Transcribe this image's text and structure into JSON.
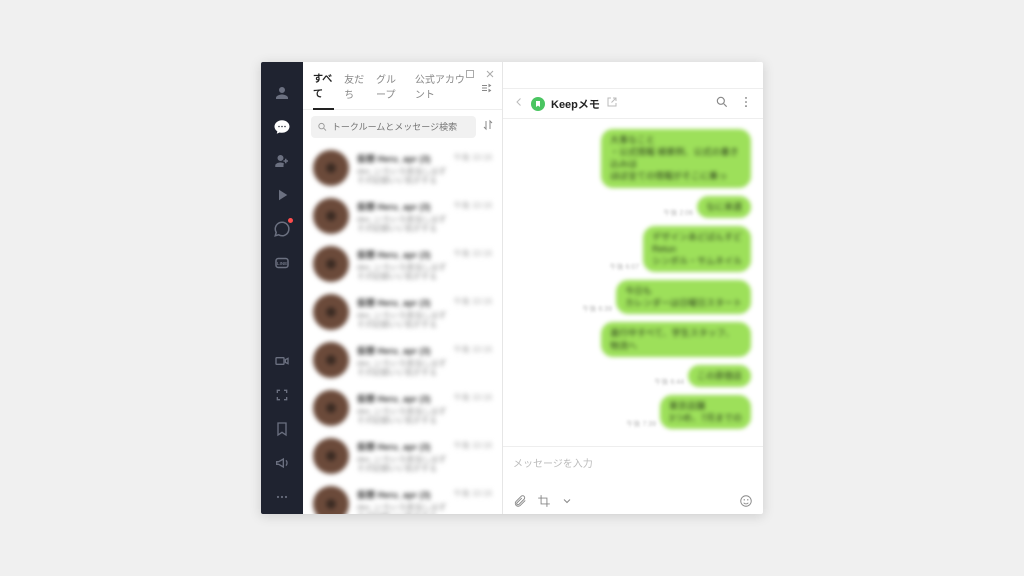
{
  "tabs": {
    "all": "すべて",
    "friends": "友だち",
    "groups": "グループ",
    "official": "公式アカウント"
  },
  "search": {
    "placeholder": "トークルームとメッセージ検索"
  },
  "chatlist": {
    "items": [
      {
        "title": "仮想 Heru_apr (3)",
        "preview": "dev_いろいろ担当しはず\nその記録いい気がする",
        "time": "午後 10:16"
      },
      {
        "title": "仮想 Heru_apr (3)",
        "preview": "dev_いろいろ担当しはず\nその記録いい気がする",
        "time": "午後 10:16"
      },
      {
        "title": "仮想 Heru_apr (3)",
        "preview": "dev_いろいろ担当しはず\nその記録いい気がする",
        "time": "午後 10:16"
      },
      {
        "title": "仮想 Heru_apr (3)",
        "preview": "dev_いろいろ担当しはず\nその記録いい気がする",
        "time": "午後 10:16"
      },
      {
        "title": "仮想 Heru_apr (3)",
        "preview": "dev_いろいろ担当しはず\nその記録いい気がする",
        "time": "午後 10:16"
      },
      {
        "title": "仮想 Heru_apr (3)",
        "preview": "dev_いろいろ担当しはず\nその記録いい気がする",
        "time": "午後 10:16"
      },
      {
        "title": "仮想 Heru_apr (3)",
        "preview": "dev_いろいろ担当しはず\nその記録いい気がする",
        "time": "午後 10:16"
      },
      {
        "title": "仮想 Heru_apr (3)",
        "preview": "dev_いろいろ担当しはず\nその記録いい気がする",
        "time": "午後 10:16"
      }
    ]
  },
  "conversation": {
    "title": "Keepメモ",
    "messages": [
      {
        "text": "大事なこと\n・公式情報 検索例、公式の書き込みは\nほぼ全ての情報がそこに乗っ",
        "time": ""
      },
      {
        "text": "なに来週",
        "time": "午後 2:06"
      },
      {
        "text": "デザインあどばんすど\nRetun\nシンボル・サムネイル",
        "time": "午後 6:07"
      },
      {
        "text": "今日も\nカレンダーは日曜日スタート",
        "time": "午後 6:39"
      },
      {
        "text": "進行中すべて、学生スタッフ、物流へ",
        "time": ""
      },
      {
        "text": "この原宿店",
        "time": "午後 6:44"
      },
      {
        "text": "東京店舗\n3つめ、7月までの",
        "time": "午後 7:39"
      }
    ],
    "input_placeholder": "メッセージを入力"
  }
}
